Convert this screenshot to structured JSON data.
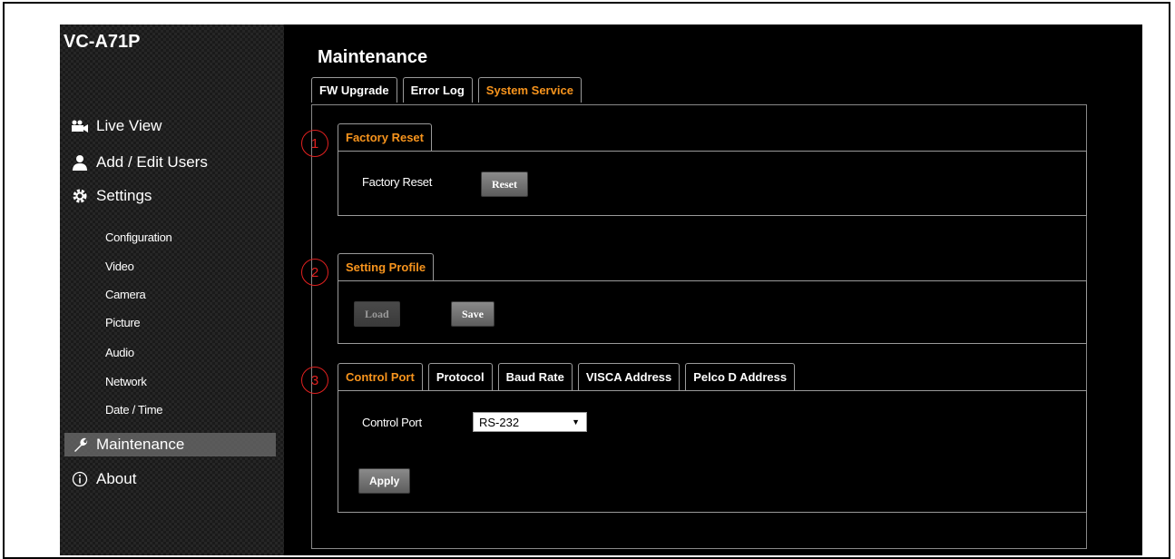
{
  "app": {
    "brand": "VC-A71P"
  },
  "sidebar": {
    "items": [
      {
        "label": "Live View",
        "icon": "camera-icon"
      },
      {
        "label": "Add / Edit Users",
        "icon": "user-icon"
      },
      {
        "label": "Settings",
        "icon": "gear-icon"
      }
    ],
    "subitems": [
      "Configuration",
      "Video",
      "Camera",
      "Picture",
      "Audio",
      "Network",
      "Date / Time"
    ],
    "maintenance": {
      "label": "Maintenance",
      "icon": "wrench-icon"
    },
    "about": {
      "label": "About",
      "icon": "info-icon"
    }
  },
  "main": {
    "title": "Maintenance",
    "tabs": [
      {
        "label": "FW Upgrade",
        "active": false
      },
      {
        "label": "Error Log",
        "active": false
      },
      {
        "label": "System Service",
        "active": true
      }
    ]
  },
  "factory_reset": {
    "tab": "Factory Reset",
    "label": "Factory Reset",
    "button": "Reset",
    "marker": "1"
  },
  "setting_profile": {
    "tab": "Setting Profile",
    "load_button": "Load",
    "save_button": "Save",
    "marker": "2"
  },
  "control": {
    "marker": "3",
    "tabs": [
      {
        "label": "Control Port",
        "active": true
      },
      {
        "label": "Protocol",
        "active": false
      },
      {
        "label": "Baud Rate",
        "active": false
      },
      {
        "label": "VISCA Address",
        "active": false
      },
      {
        "label": "Pelco D Address",
        "active": false
      }
    ],
    "field_label": "Control Port",
    "select_value": "RS-232",
    "apply_button": "Apply"
  },
  "colors": {
    "accent": "#f7941d",
    "marker": "#e0201f"
  }
}
